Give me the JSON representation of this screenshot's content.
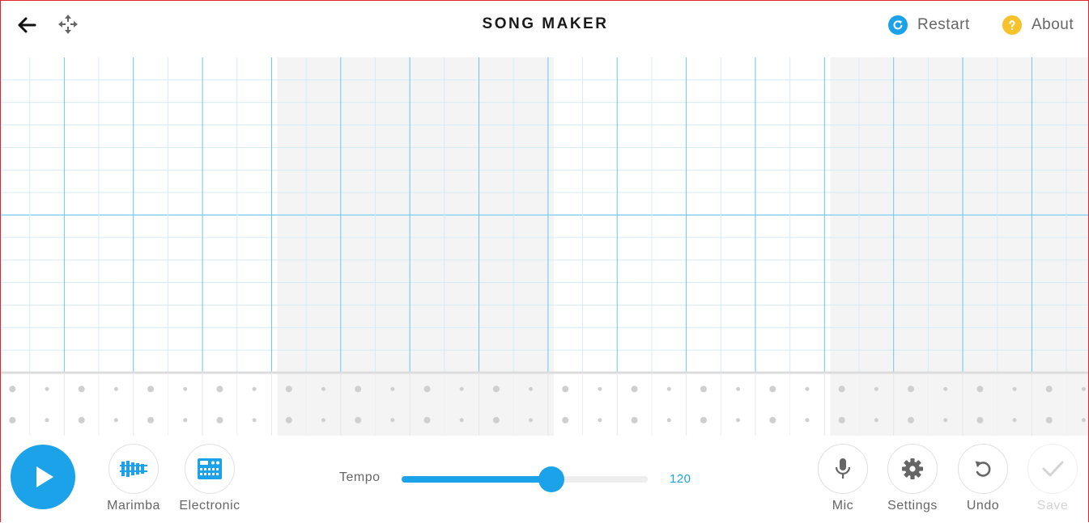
{
  "header": {
    "title": "SONG MAKER",
    "restart_label": "Restart",
    "about_label": "About",
    "icons": {
      "back": "arrow-left-icon",
      "move": "move-arrows-icon",
      "restart": "restart-icon",
      "about": "question-icon"
    }
  },
  "grid": {
    "columns": 32,
    "beats_per_bar": 4,
    "melody_rows": 14,
    "percussion_rows": 2
  },
  "instruments": {
    "melody_label": "Marimba",
    "rhythm_label": "Electronic"
  },
  "tempo": {
    "label": "Tempo",
    "value": "120",
    "level_fraction": 0.61
  },
  "controls": {
    "mic_label": "Mic",
    "settings_label": "Settings",
    "undo_label": "Undo",
    "save_label": "Save"
  },
  "colors": {
    "accent": "#1ca2e8",
    "shade_bar": "#f4f4f4",
    "about_badge": "#f8c22c"
  }
}
